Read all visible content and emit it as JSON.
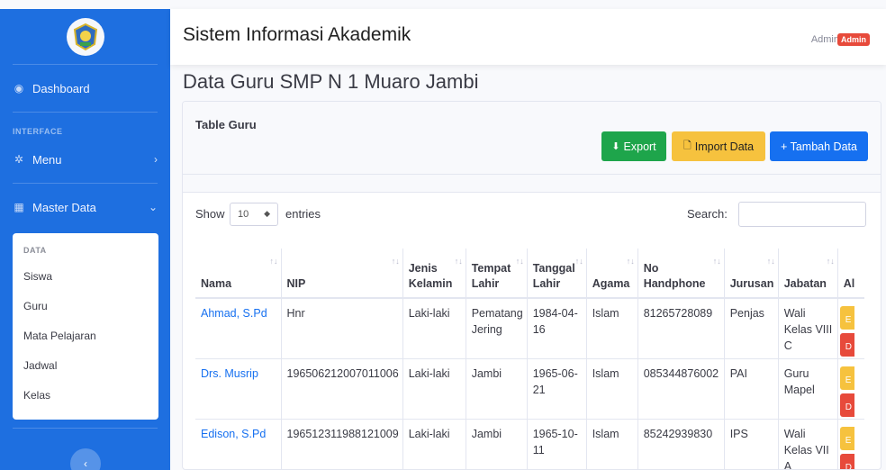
{
  "sidebar": {
    "dashboard": "Dashboard",
    "heading_interface": "INTERFACE",
    "menu": "Menu",
    "master_data": "Master Data",
    "sub_heading": "DATA",
    "sub_items": [
      "Siswa",
      "Guru",
      "Mata Pelajaran",
      "Jadwal",
      "Kelas"
    ]
  },
  "topbar": {
    "title": "Sistem Informasi Akademik",
    "user_name": "Admin",
    "user_badge": "Admin"
  },
  "page": {
    "title": "Data Guru SMP N 1 Muaro Jambi"
  },
  "card": {
    "title": "Table Guru",
    "export": "Export",
    "import": "Import Data",
    "add": "+ Tambah Data",
    "show": "Show",
    "entries_value": "10",
    "entries": "entries",
    "search": "Search:"
  },
  "table": {
    "headers": [
      "Nama",
      "NIP",
      "Jenis Kelamin",
      "Tempat Lahir",
      "Tanggal Lahir",
      "Agama",
      "No Handphone",
      "Jurusan",
      "Jabatan",
      "Al"
    ],
    "rows": [
      [
        "Ahmad, S.Pd",
        "Hnr",
        "Laki-laki",
        "Pematang Jering",
        "1984-04-16",
        "Islam",
        "81265728089",
        "Penjas",
        "Wali Kelas VIII C"
      ],
      [
        "Drs. Musrip",
        "196506212007011006",
        "Laki-laki",
        "Jambi",
        "1965-06-21",
        "Islam",
        "085344876002",
        "PAI",
        "Guru Mapel"
      ],
      [
        "Edison, S.Pd",
        "196512311988121009",
        "Laki-laki",
        "Jambi",
        "1965-10-11",
        "Islam",
        "85242939830",
        "IPS",
        "Wali Kelas VII A"
      ]
    ],
    "action_edit": "E",
    "action_delete": "D"
  },
  "colors": {
    "sidebar": "#1e6fe0",
    "export": "#1ea54b",
    "import": "#f6c23e",
    "add": "#1670f0",
    "badge": "#e74a3b"
  }
}
